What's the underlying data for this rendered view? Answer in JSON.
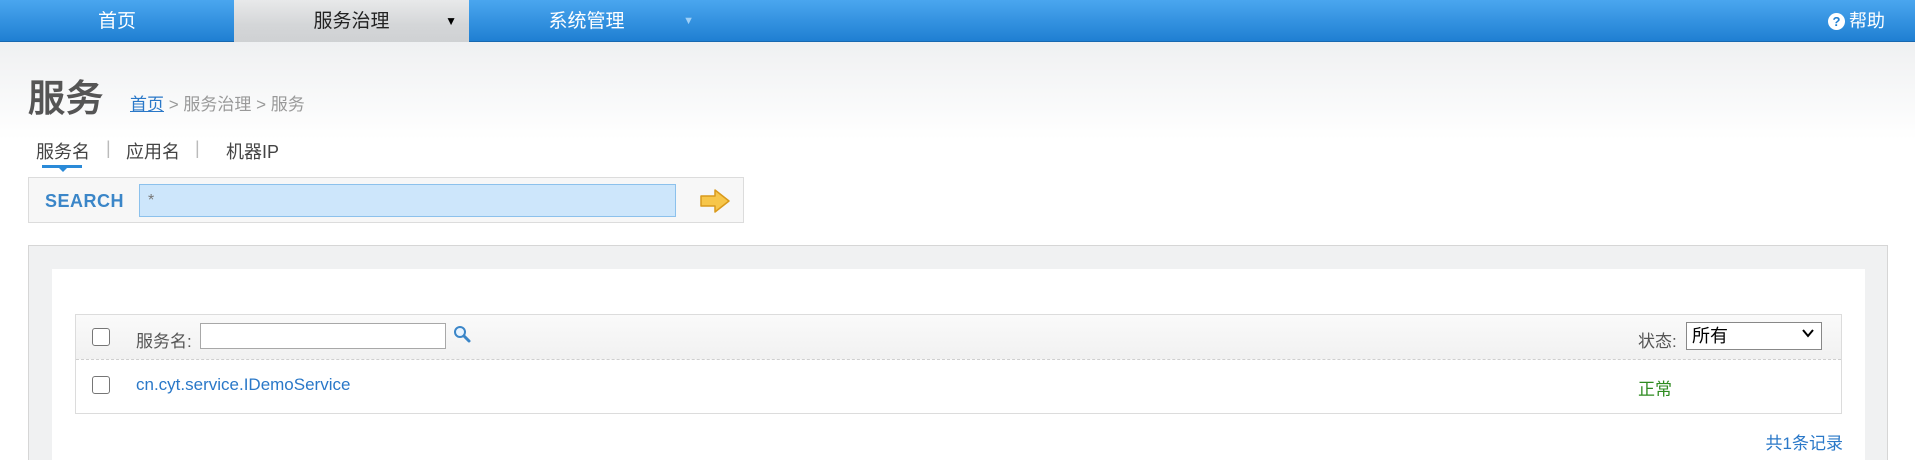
{
  "topnav": {
    "items": [
      {
        "label": "首页"
      },
      {
        "label": "服务治理",
        "arrow": "▼"
      },
      {
        "label": "系统管理",
        "arrow": "▼"
      }
    ],
    "help": {
      "icon_glyph": "?",
      "label": "帮助"
    }
  },
  "page": {
    "title": "服务",
    "breadcrumb": {
      "home": "首页",
      "sep1": " > ",
      "level2": "服务治理",
      "sep2": " > ",
      "current": "服务"
    }
  },
  "search": {
    "tabs": [
      {
        "label": "服务名",
        "active": true
      },
      {
        "label": "应用名"
      },
      {
        "label": "机器IP"
      }
    ],
    "separator": "|",
    "label": "SEARCH",
    "value": "*"
  },
  "table": {
    "filter_label": "服务名:",
    "filter_value": "",
    "status_label": "状态:",
    "status_selected": "所有",
    "rows": [
      {
        "service": "cn.cyt.service.IDemoService",
        "status": "正常"
      }
    ],
    "record_count": "共1条记录"
  },
  "colors": {
    "nav_blue": "#1f7fd2",
    "link": "#2a78c8",
    "status_ok": "#2e8b20",
    "search_input_bg": "#cde6fb"
  }
}
